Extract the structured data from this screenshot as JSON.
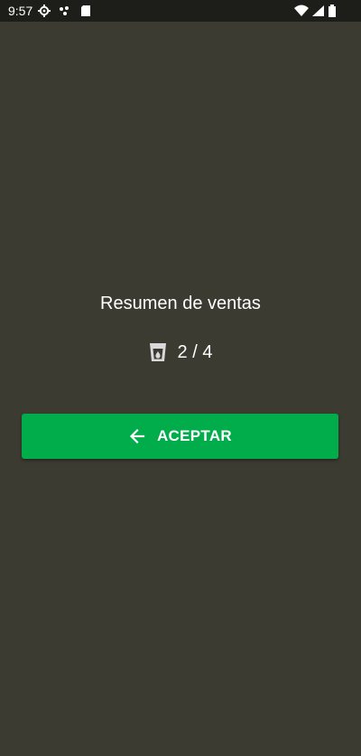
{
  "status_bar": {
    "time": "9:57",
    "icons": [
      "settings-icon",
      "dots-icon",
      "sd-card-icon",
      "wifi-icon",
      "signal-icon",
      "battery-icon"
    ]
  },
  "summary": {
    "title": "Resumen de ventas",
    "count": "2 / 4",
    "icon": "glass-icon"
  },
  "actions": {
    "accept_label": "ACEPTAR",
    "accept_icon": "arrow-left-icon"
  },
  "colors": {
    "background": "#3b3b31",
    "status_bar": "#1d1d19",
    "accent": "#00ad4a",
    "text": "#ffffff",
    "icon_muted": "#d9d9d9"
  }
}
